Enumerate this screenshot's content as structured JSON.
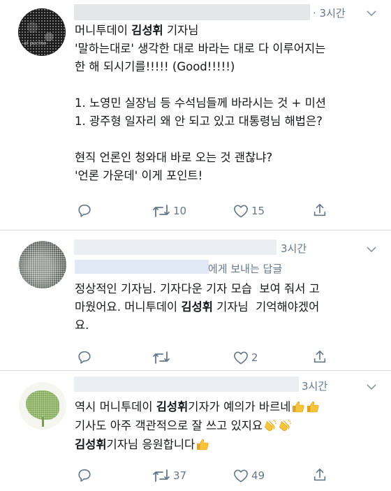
{
  "tweets": [
    {
      "time": "· 3시간",
      "lines": [
        [
          {
            "t": "머니투데이 "
          },
          {
            "t": "김성휘",
            "b": true
          },
          {
            "t": " 기자님"
          }
        ],
        [
          {
            "t": "'말하는대로' 생각한 대로 바라는 대로 다 이루어지는"
          }
        ],
        [
          {
            "t": "한 해 되시기를!!!!! (Good!!!!!)"
          }
        ],
        [
          {
            "t": ""
          }
        ],
        [
          {
            "t": "1. 노영민 실장님 등 수석님들께 바라시는 것 + 미션"
          }
        ],
        [
          {
            "t": "1. 광주형 일자리 왜 안 되고 있고 대통령님 해법은?"
          }
        ],
        [
          {
            "t": ""
          }
        ],
        [
          {
            "t": "현직 언론인 청와대 바로 오는 것 괜찮냐?"
          }
        ],
        [
          {
            "t": "'언론 가운데' 이게 포인트!"
          }
        ]
      ],
      "retweets": "10",
      "likes": "15",
      "avatar_text": "al pacino"
    },
    {
      "time": "3시간",
      "reply_to": "에게 보내는 답글",
      "lines": [
        [
          {
            "t": "정상적인 기자님. 기자다운 기자 모습  보여 줘서 고"
          }
        ],
        [
          {
            "t": "마웠어요. 머니투데이 "
          },
          {
            "t": "김성휘",
            "b": true
          },
          {
            "t": " 기자님  기억해야겠어"
          }
        ],
        [
          {
            "t": "요."
          }
        ]
      ],
      "retweets": "",
      "likes": "2"
    },
    {
      "time": "3시간",
      "lines": [
        [
          {
            "t": "역시 머니투데이 "
          },
          {
            "t": "김성휘",
            "b": true
          },
          {
            "t": "기자가 예의가 바르네"
          },
          {
            "e": "thumbs-up"
          },
          {
            "e": "thumbs-up"
          }
        ],
        [
          {
            "t": "기사도 아주 객관적으로 잘 쓰고 있지요"
          },
          {
            "e": "clap"
          },
          {
            "e": "clap"
          }
        ],
        [
          {
            "t": "김성휘",
            "b": true
          },
          {
            "t": "기자님 응원합니다"
          },
          {
            "e": "thumbs-up"
          }
        ]
      ],
      "retweets": "37",
      "likes": "49"
    }
  ],
  "icons": {
    "reply": "reply-icon",
    "retweet": "retweet-icon",
    "like": "heart-icon",
    "share": "share-icon",
    "more": "chevron-down-icon"
  },
  "colors": {
    "icon_gray": "#657786",
    "text": "#14171a",
    "divider": "#d6dde3",
    "emoji_yellow": "#f6c43a"
  }
}
